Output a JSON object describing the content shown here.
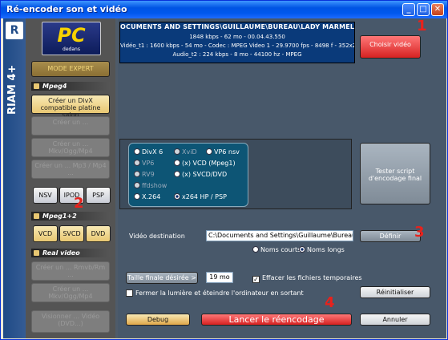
{
  "window": {
    "title": "Ré-encoder son et vidéo",
    "minimize": "_",
    "maximize": "□",
    "close": "✕"
  },
  "branding": {
    "left_logo": "R",
    "vertical_logo": "RIAM 4+",
    "pc_logo": "PC",
    "pc_logo_sub": "dedans"
  },
  "sidebar": {
    "mode_expert": "MODE EXPERT",
    "mpeg4_title": "Mpeg4",
    "divx_label": "Créer un DivX compatible platine salon",
    "item2": "Créer un ...",
    "item3": "Créer un ... Mkv/Ogg/Mp4",
    "item4": "Créer un ... Mp3 / Mp4 ...",
    "nsv": "NSV",
    "ipod": "IPOD",
    "psp": "PSP",
    "mpeg12_title": "Mpeg1+2",
    "vcd": "VCD",
    "svcd": "SVCD",
    "dvd": "DVD",
    "realvideo_title": "Real video",
    "rv_item1": "Créer un ... Rmvb/Rm ...",
    "rv_item2": "Créer un ... Mkv/Ogg/Mp4",
    "rv_item3": "Visionner ... Vidéo (DVD...)"
  },
  "info": {
    "path": "OCUMENTS AND SETTINGS\\GUILLAUME\\BUREAU\\LADY MARMELADE",
    "line2": "1848 kbps - 62 mo - 00.04.43.550",
    "line3": "Vidéo_t1 : 1600 kbps - 54 mo - Codec : MPEG Video 1 - 29.9700 fps - 8498 f - 352x240",
    "line4": "Audio_t2 : 224 kbps - 8 mo - 44100 hz - MPEG"
  },
  "choose_video": "Choisir vidéo",
  "codecs": {
    "divx6": "DivX 6",
    "xvid": "XviD",
    "vp6nsv": "VP6 nsv",
    "vp6": "VP6",
    "vcd_mpeg1": "(x) VCD (Mpeg1)",
    "rv9": "RV9",
    "svcd_dvd": "(x) SVCD/DVD",
    "ffdshow": "ffdshow",
    "x264": "X.264",
    "x264hp": "x264 HP / PSP"
  },
  "test_script": "Tester script d'encodage final",
  "destination": {
    "label": "Vidéo destination",
    "value": "C:\\Documents and Settings\\Guillaume\\Bureau\\OUT_LADY",
    "define": "Définir",
    "short_names": "Noms courts",
    "long_names": "Noms longs"
  },
  "final_size": {
    "button": "Taille finale désirée >",
    "value": "19 mo",
    "delete_temp": "Effacer les fichiers temporaires",
    "delete_temp_checked": "✓"
  },
  "shutdown": "Fermer la lumière et éteindre l'ordinateur en sortant",
  "reset": "Réinitialiser",
  "debug": "Debug",
  "launch": "Lancer le réencodage",
  "cancel": "Annuler",
  "markers": [
    "1",
    "2",
    "3",
    "4"
  ]
}
